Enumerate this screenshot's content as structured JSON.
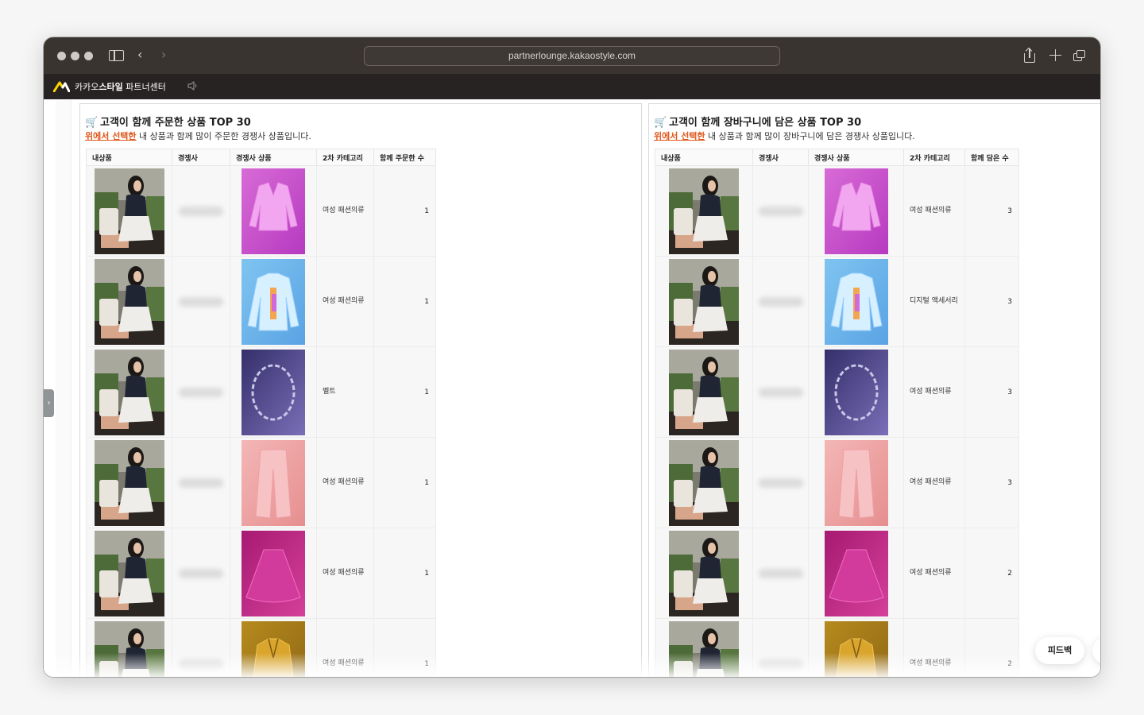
{
  "browser": {
    "url": "partnerlounge.kakaostyle.com"
  },
  "app": {
    "title_prefix": "카카오",
    "title_bold": "스타일",
    "title_suffix": " 파트너센터"
  },
  "panels": [
    {
      "title": "고객이 함께 주문한 상품 TOP 30",
      "desc_highlight": "위에서 선택한",
      "desc_rest": " 내 상품과 함께 많이 주문한 경쟁사 상품입니다.",
      "headers": [
        "내상품",
        "경쟁사",
        "경쟁사 상품",
        "2차 카테고리",
        "함께 주문한 수"
      ],
      "rows": [
        {
          "category": "여성 패션의류",
          "count": "1",
          "product": "cardigan-pink"
        },
        {
          "category": "여성 패션의류",
          "count": "1",
          "product": "jacket-iridescent"
        },
        {
          "category": "벨트",
          "count": "1",
          "product": "chain-belt"
        },
        {
          "category": "여성 패션의류",
          "count": "1",
          "product": "pants-pink"
        },
        {
          "category": "여성 패션의류",
          "count": "1",
          "product": "skirt-magenta"
        },
        {
          "category": "여성 패션의류",
          "count": "1",
          "product": "jacket-gold"
        }
      ]
    },
    {
      "title": "고객이 함께 장바구니에 담은 상품 TOP 30",
      "desc_highlight": "위에서 선택한",
      "desc_rest": " 내 상품과 함께 많이 장바구니에 담은 경쟁사 상품입니다.",
      "headers": [
        "내상품",
        "경쟁사",
        "경쟁사 상품",
        "2차 카테고리",
        "함께 담은 수"
      ],
      "rows": [
        {
          "category": "여성 패션의류",
          "count": "3",
          "product": "cardigan-pink"
        },
        {
          "category": "디지털 액세서리",
          "count": "3",
          "product": "jacket-iridescent"
        },
        {
          "category": "여성 패션의류",
          "count": "3",
          "product": "chain-belt"
        },
        {
          "category": "여성 패션의류",
          "count": "3",
          "product": "pants-pink"
        },
        {
          "category": "여성 패션의류",
          "count": "2",
          "product": "skirt-magenta"
        },
        {
          "category": "여성 패션의류",
          "count": "2",
          "product": "jacket-gold"
        }
      ]
    }
  ],
  "feedback_label": "피드백"
}
